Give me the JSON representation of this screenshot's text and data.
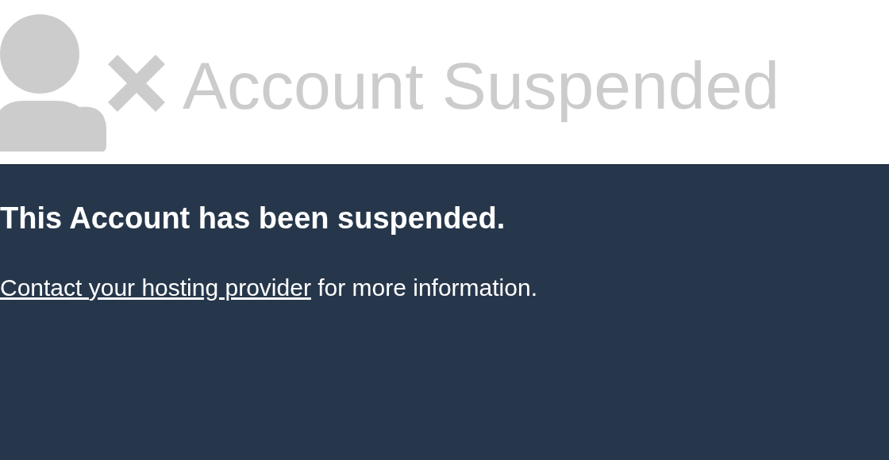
{
  "header": {
    "title": "Account Suspended"
  },
  "notice": {
    "heading": "This Account has been suspended.",
    "link": "Contact your hosting provider",
    "text": "for more information."
  }
}
